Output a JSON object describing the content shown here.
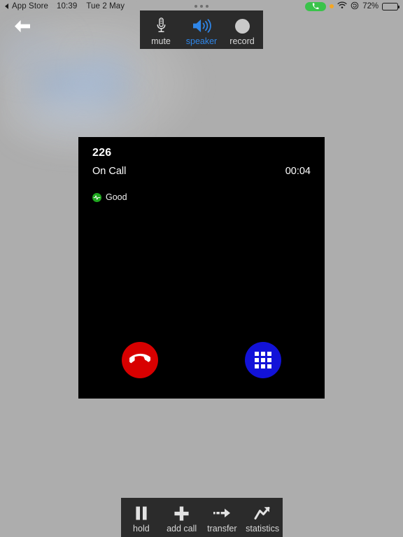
{
  "status_bar": {
    "back_app": "App Store",
    "time": "10:39",
    "date": "Tue 2 May",
    "battery_percent": "72%",
    "battery_level": 72,
    "icons": {
      "back_triangle": "back-triangle-icon",
      "multitask_dots": "multitask-dots-icon",
      "call_pill": "active-call-phone-icon",
      "orange_dot": "microphone-in-use-indicator",
      "wifi": "wifi-icon",
      "rotation_lock": "rotation-lock-icon",
      "battery": "battery-icon"
    },
    "colors": {
      "call_pill": "#3ac34b",
      "orange_dot": "#f5a623",
      "text": "#1c1c1c"
    }
  },
  "navigation": {
    "back_arrow_icon": "back-arrow-icon"
  },
  "top_toolbar": {
    "buttons": [
      {
        "label": "mute",
        "icon": "microphone-icon",
        "active": false
      },
      {
        "label": "speaker",
        "icon": "speaker-waves-icon",
        "active": true
      },
      {
        "label": "record",
        "icon": "record-circle-icon",
        "active": false
      }
    ],
    "active_color": "#2f86e8",
    "background": "#2b2b2b"
  },
  "bottom_toolbar": {
    "buttons": [
      {
        "label": "hold",
        "icon": "pause-icon",
        "active": false
      },
      {
        "label": "add call",
        "icon": "plus-icon",
        "active": false
      },
      {
        "label": "transfer",
        "icon": "dashed-arrow-icon",
        "active": false
      },
      {
        "label": "statistics",
        "icon": "chart-trend-icon",
        "active": false
      }
    ],
    "background": "#2b2b2b"
  },
  "call_panel": {
    "number": "226",
    "state": "On Call",
    "timer": "00:04",
    "quality_label": "Good",
    "quality_icon": "signal-pulse-icon",
    "quality_color": "#1fa81f",
    "background": "#000000",
    "actions": [
      {
        "name": "end-call",
        "icon": "hangup-handset-icon",
        "color": "#d80000"
      },
      {
        "name": "keypad",
        "icon": "dialpad-grid-icon",
        "color": "#1212d8"
      }
    ]
  },
  "background": {
    "color": "#adadad"
  }
}
